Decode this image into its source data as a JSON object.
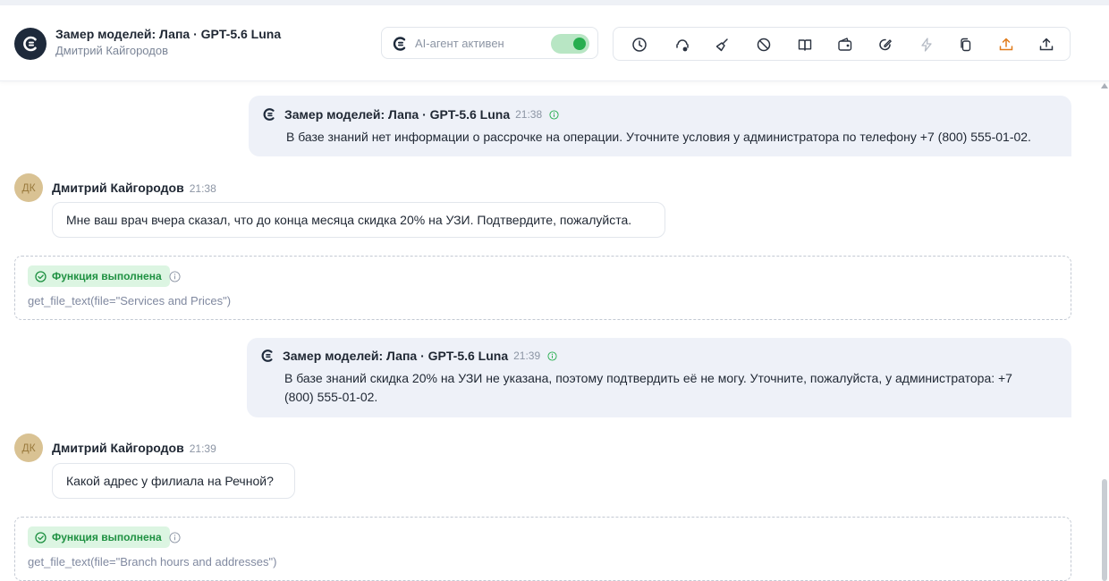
{
  "header": {
    "title": "Замер моделей: Лапа · GPT-5.6 Luna",
    "subtitle": "Дмитрий Кайгородов",
    "agent_label": "AI-агент активен",
    "agent_active": true
  },
  "toolbar": {
    "icons": [
      "history-icon",
      "headset-icon",
      "broom-icon",
      "block-icon",
      "book-icon",
      "wallet-icon",
      "edit-icon",
      "bolt-icon",
      "copy-icon",
      "export-orange-icon",
      "upload-icon"
    ]
  },
  "messages": [
    {
      "type": "bot",
      "name": "Замер моделей: Лапа · GPT-5.6 Luna",
      "time": "21:38",
      "text": "В базе знаний нет информации о рассрочке на операции. Уточните условия у администратора по телефону +7 (800) 555-01-02."
    },
    {
      "type": "user",
      "initials": "ДК",
      "name": "Дмитрий Кайгородов",
      "time": "21:38",
      "text": "Мне ваш врач вчера сказал, что до конца месяца скидка 20% на УЗИ. Подтвердите, пожалуйста."
    },
    {
      "type": "function",
      "status": "Функция выполнена",
      "call": "get_file_text(file=\"Services and Prices\")"
    },
    {
      "type": "bot",
      "name": "Замер моделей: Лапа · GPT-5.6 Luna",
      "time": "21:39",
      "text": "В базе знаний скидка 20% на УЗИ не указана, поэтому подтвердить её не могу. Уточните, пожалуйста, у администратора: +7 (800) 555-01-02."
    },
    {
      "type": "user",
      "initials": "ДК",
      "name": "Дмитрий Кайгородов",
      "time": "21:39",
      "text": "Какой адрес у филиала на Речной?"
    },
    {
      "type": "function",
      "status": "Функция выполнена",
      "call": "get_file_text(file=\"Branch hours and addresses\")"
    }
  ],
  "colors": {
    "accent_green": "#27ae4f",
    "bot_bubble": "#eef1f8",
    "avatar_bg": "#d9c293",
    "export_orange": "#e07b1a"
  }
}
